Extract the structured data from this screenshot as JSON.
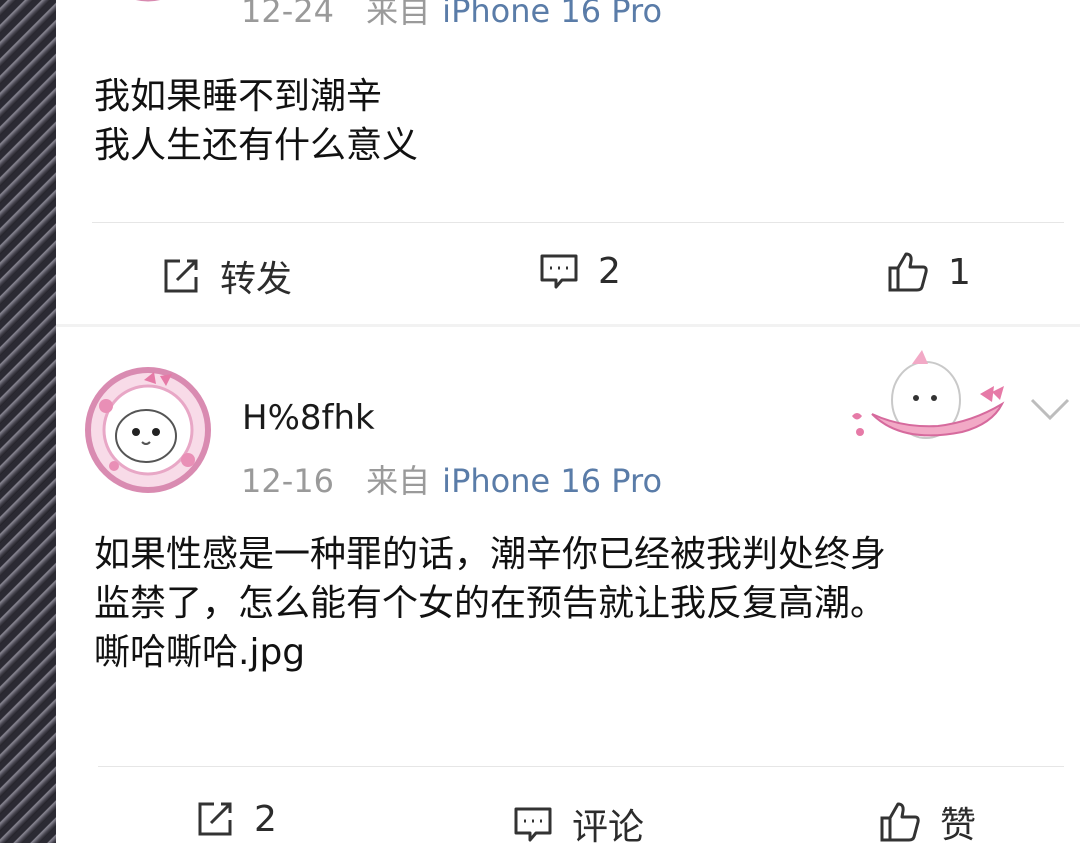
{
  "post1": {
    "date": "12-24",
    "source_prefix": "来自",
    "source_device": "iPhone 16 Pro",
    "text": "我如果睡不到潮辛\n我人生还有什么意义",
    "actions": {
      "repost_label": "转发",
      "comment_count": "2",
      "like_count": "1"
    }
  },
  "post2": {
    "username": "H%8fhk",
    "date": "12-16",
    "source_prefix": "来自",
    "source_device": "iPhone 16 Pro",
    "text": "如果性感是一种罪的话，潮辛你已经被我判处终身\n监禁了，怎么能有个女的在预告就让我反复高潮。\n嘶哈嘶哈.jpg",
    "actions": {
      "repost_count": "2",
      "comment_label": "评论",
      "like_label": "赞"
    }
  },
  "colors": {
    "source_link": "#5a7ca8",
    "meta_gray": "#9a9a9a",
    "avatar_pink": "#f2a9c6"
  },
  "icons": [
    "repost-icon",
    "comment-icon",
    "like-icon",
    "chevron-down-icon",
    "avatar-icon",
    "badge-sticker-icon"
  ]
}
